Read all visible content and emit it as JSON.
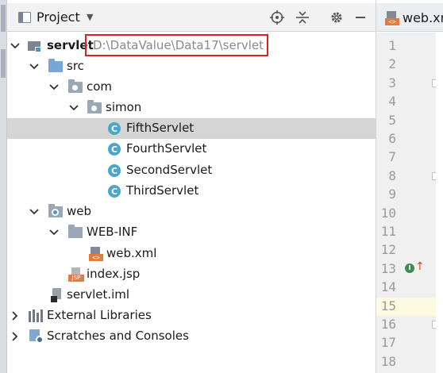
{
  "panel": {
    "title": "Project"
  },
  "tree": {
    "root": {
      "label": "servlet",
      "path": "D:\\DataValue\\Data17\\servlet"
    },
    "src": {
      "label": "src"
    },
    "com": {
      "label": "com"
    },
    "simon": {
      "label": "simon"
    },
    "classes": [
      {
        "label": "FifthServlet",
        "selected": true
      },
      {
        "label": "FourthServlet"
      },
      {
        "label": "SecondServlet"
      },
      {
        "label": "ThirdServlet"
      }
    ],
    "web": {
      "label": "web"
    },
    "webinf": {
      "label": "WEB-INF"
    },
    "webxml": {
      "label": "web.xml"
    },
    "indexjsp": {
      "label": "index.jsp"
    },
    "iml": {
      "label": "servlet.iml"
    },
    "extlibs": {
      "label": "External Libraries"
    },
    "scratches": {
      "label": "Scratches and Consoles"
    }
  },
  "editor": {
    "tab_label": "web.xm",
    "line_numbers": [
      "1",
      "2",
      "3",
      "4",
      "5",
      "6",
      "7",
      "8",
      "9",
      "10",
      "11",
      "12",
      "13",
      "14",
      "15",
      "16",
      "17",
      "18"
    ],
    "current_line": "15"
  },
  "icons": {
    "header": [
      "project-icon",
      "chevron-down-icon",
      "crosshair-icon",
      "collapse-all-icon",
      "gear-icon",
      "minimize-icon"
    ]
  },
  "colors": {
    "selection": "#d5d5d5",
    "highlight_box": "#e02020",
    "path_text": "#8a8a8a",
    "current_line": "#fcfae1"
  }
}
